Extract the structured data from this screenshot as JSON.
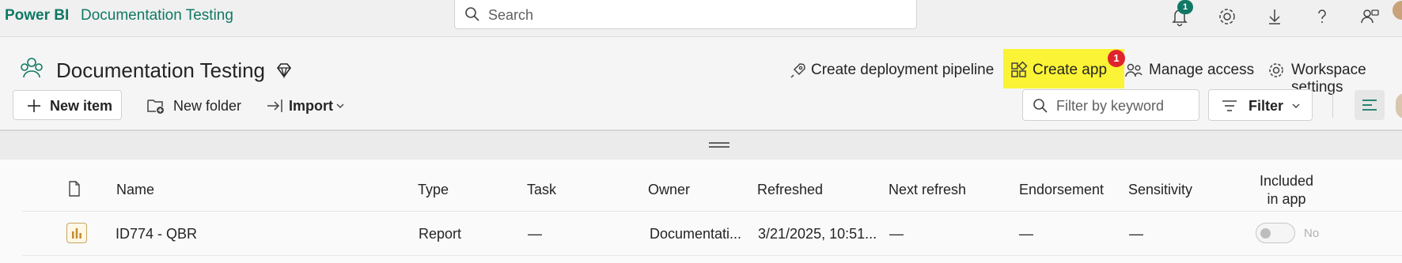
{
  "topbar": {
    "brand": "Power BI",
    "breadcrumb": "Documentation Testing",
    "search_placeholder": "Search",
    "notification_count": "1"
  },
  "workspace": {
    "title": "Documentation Testing",
    "actions": {
      "create_pipeline": "Create deployment pipeline",
      "create_app": "Create app",
      "create_app_badge": "1",
      "manage_access": "Manage access",
      "workspace_settings": "Workspace settings"
    }
  },
  "toolbar": {
    "new_item": "New item",
    "new_folder": "New folder",
    "import": "Import",
    "filter_placeholder": "Filter by keyword",
    "filter": "Filter"
  },
  "table": {
    "columns": {
      "name": "Name",
      "type": "Type",
      "task": "Task",
      "owner": "Owner",
      "refreshed": "Refreshed",
      "next_refresh": "Next refresh",
      "endorsement": "Endorsement",
      "sensitivity": "Sensitivity",
      "included_line1": "Included",
      "included_line2": "in app"
    },
    "rows": [
      {
        "name": "ID774 - QBR",
        "type": "Report",
        "task": "—",
        "owner": "Documentati...",
        "refreshed": "3/21/2025, 10:51...",
        "next_refresh": "—",
        "endorsement": "—",
        "sensitivity": "—",
        "included_label": "No"
      }
    ]
  },
  "colors": {
    "brand": "#117865",
    "highlight": "#fbf335",
    "badge_red": "#e0242c"
  }
}
